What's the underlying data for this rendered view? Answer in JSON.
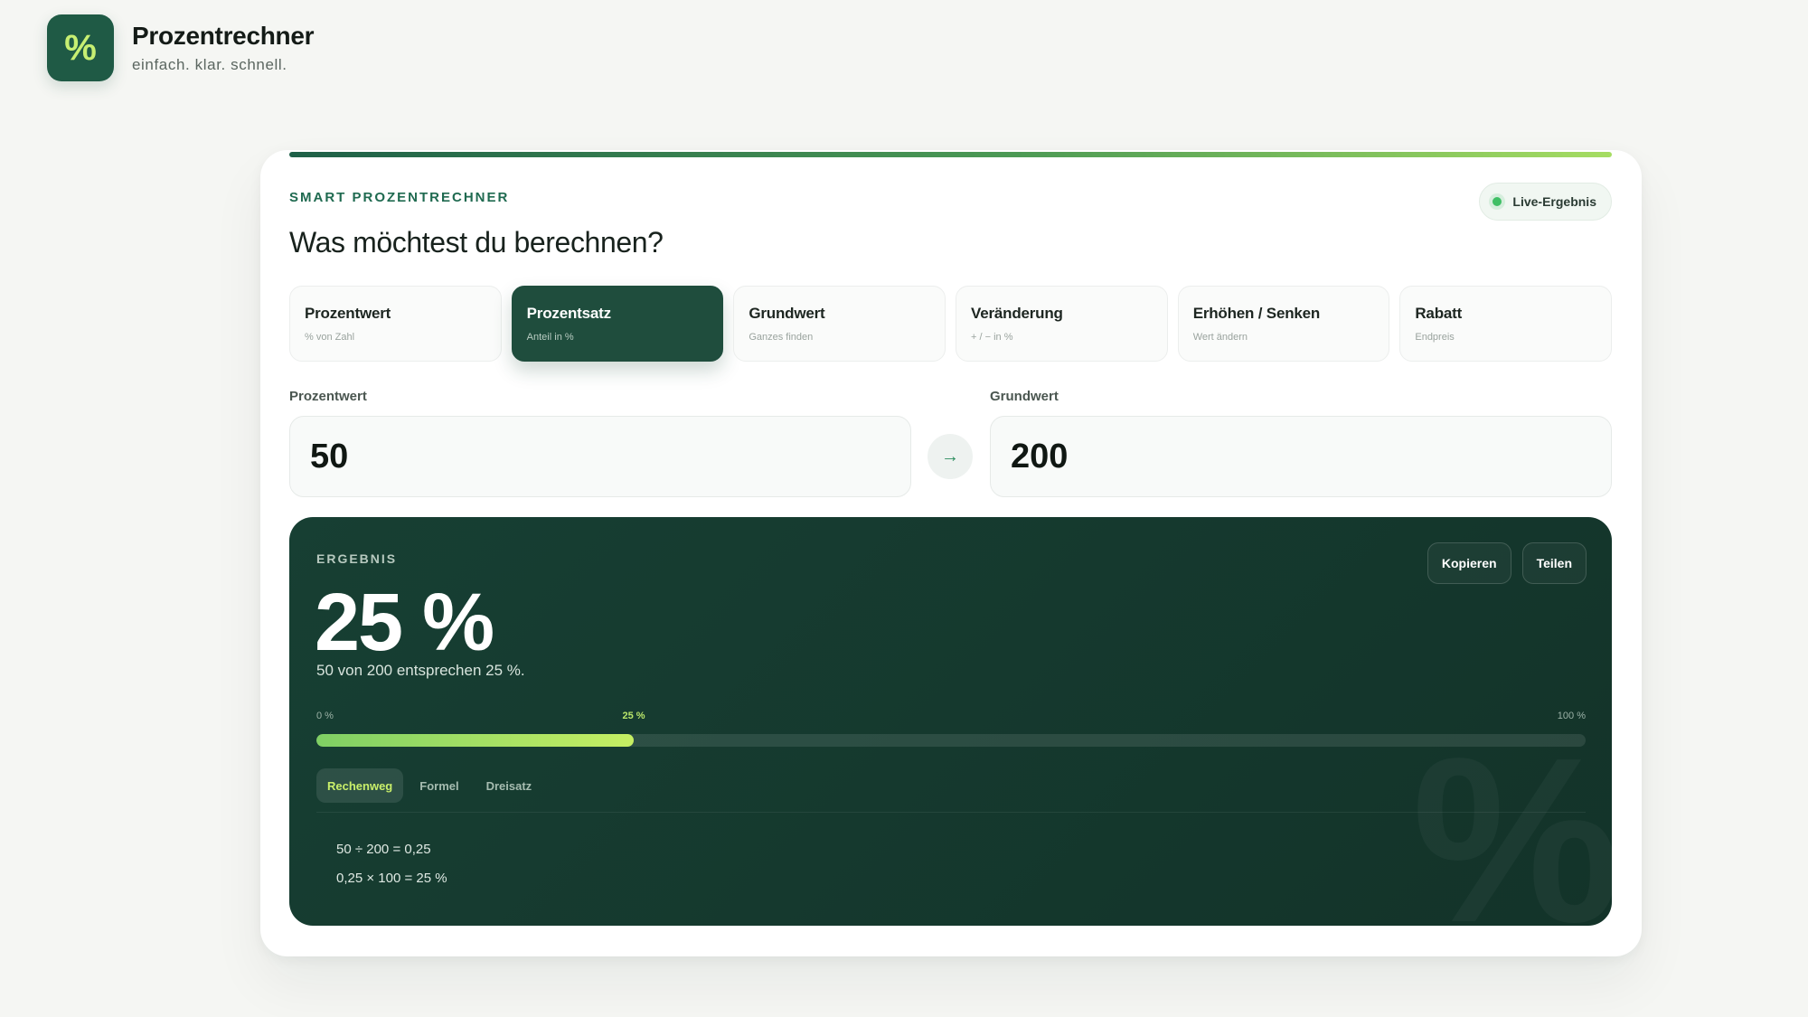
{
  "app": {
    "title": "Prozentrechner",
    "subtitle": "einfach. klar. schnell.",
    "logo_glyph": "%"
  },
  "card": {
    "eyebrow": "SMART PROZENTRECHNER",
    "heading": "Was möchtest du berechnen?",
    "live_badge": "Live-Ergebnis"
  },
  "modes": [
    {
      "label": "Prozentwert",
      "sub": "% von Zahl",
      "active": false
    },
    {
      "label": "Prozentsatz",
      "sub": "Anteil in %",
      "active": true
    },
    {
      "label": "Grundwert",
      "sub": "Ganzes finden",
      "active": false
    },
    {
      "label": "Veränderung",
      "sub": "+ / − in %",
      "active": false
    },
    {
      "label": "Erhöhen / Senken",
      "sub": "Wert ändern",
      "active": false
    },
    {
      "label": "Rabatt",
      "sub": "Endpreis",
      "active": false
    }
  ],
  "inputs": {
    "left": {
      "label": "Prozentwert",
      "value": "50"
    },
    "right": {
      "label": "Grundwert",
      "value": "200"
    },
    "swap_icon": "arrow-right-icon",
    "swap_glyph": "→"
  },
  "result": {
    "eyebrow": "ERGEBNIS",
    "value": "25 %",
    "sentence": "50 von 200 entsprechen 25 %.",
    "actions": {
      "copy": "Kopieren",
      "share": "Teilen"
    },
    "scale": {
      "start": "0 %",
      "mid": "25 %",
      "end": "100 %"
    },
    "progress_fraction": 0.25,
    "subtabs": [
      {
        "label": "Rechenweg",
        "active": true
      },
      {
        "label": "Formel",
        "active": false
      },
      {
        "label": "Dreisatz",
        "active": false
      }
    ],
    "steps": [
      "50 ÷ 200 = 0,25",
      "0,25 × 100 = 25 %"
    ],
    "watermark": "%"
  },
  "colors": {
    "brand": "#1f4d3d",
    "accent": "#c6ef63",
    "result_bg": "#173f33"
  }
}
